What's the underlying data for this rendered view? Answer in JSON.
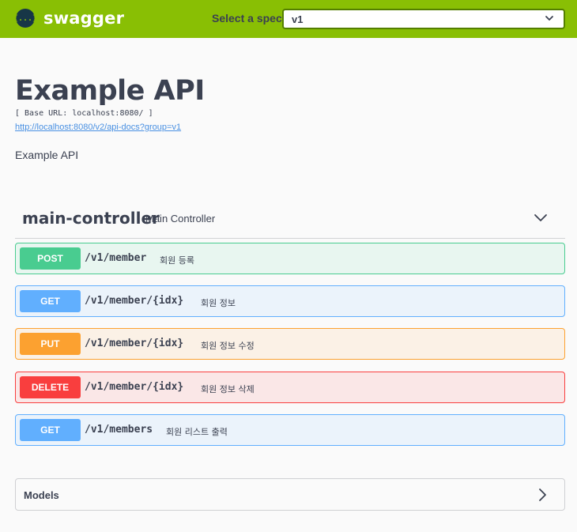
{
  "topbar": {
    "logo_glyph": "{...}",
    "logo_text": "swagger",
    "spec_label": "Select a spec",
    "spec_value": "v1",
    "color": "#89bf04"
  },
  "info": {
    "title": "Example API",
    "base_url": "[ Base URL: localhost:8080/ ]",
    "docs_link": "http://localhost:8080/v2/api-docs?group=v1",
    "description": "Example API"
  },
  "tag": {
    "name": "main-controller",
    "description": "Main Controller"
  },
  "operations": [
    {
      "method": "POST",
      "path": "/v1/member",
      "summary": "회원 등록",
      "color": "#49cc90"
    },
    {
      "method": "GET",
      "path": "/v1/member/{idx}",
      "summary": "회원 정보",
      "color": "#61affe"
    },
    {
      "method": "PUT",
      "path": "/v1/member/{idx}",
      "summary": "회원 정보 수정",
      "color": "#fca130"
    },
    {
      "method": "DELETE",
      "path": "/v1/member/{idx}",
      "summary": "회원 정보 삭제",
      "color": "#f93e3e"
    },
    {
      "method": "GET",
      "path": "/v1/members",
      "summary": "회원 리스트 출력",
      "color": "#61affe"
    }
  ],
  "models": {
    "label": "Models"
  }
}
